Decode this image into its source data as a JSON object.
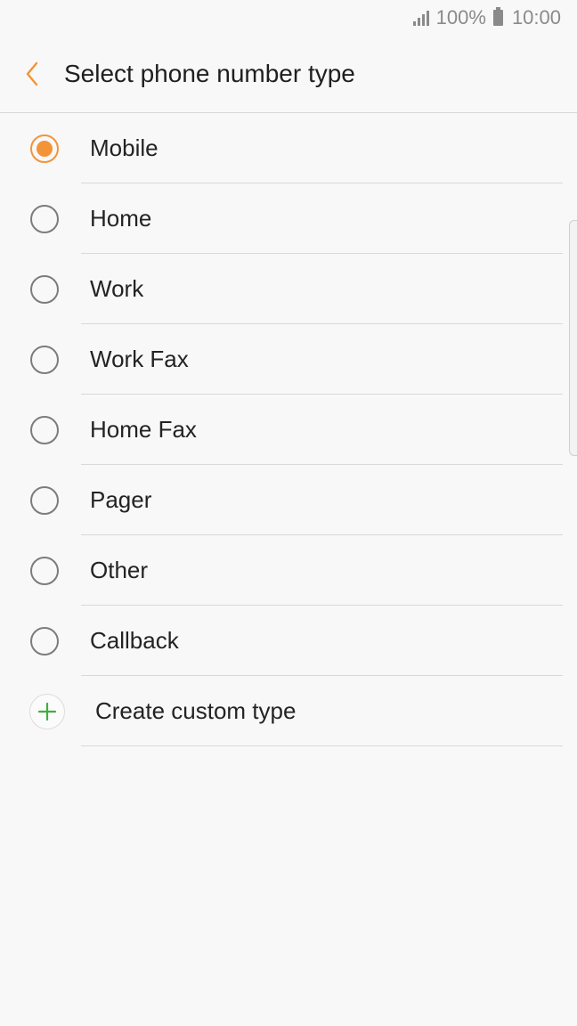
{
  "status_bar": {
    "battery_text": "100%",
    "time": "10:00"
  },
  "header": {
    "title": "Select phone number type",
    "back_icon": "chevron-left-icon",
    "accent_color": "#f39437"
  },
  "options": [
    {
      "label": "Mobile",
      "selected": true
    },
    {
      "label": "Home",
      "selected": false
    },
    {
      "label": "Work",
      "selected": false
    },
    {
      "label": "Work Fax",
      "selected": false
    },
    {
      "label": "Home Fax",
      "selected": false
    },
    {
      "label": "Pager",
      "selected": false
    },
    {
      "label": "Other",
      "selected": false
    },
    {
      "label": "Callback",
      "selected": false
    }
  ],
  "custom": {
    "label": "Create custom type",
    "icon": "plus-icon",
    "icon_color": "#3fae3f"
  }
}
